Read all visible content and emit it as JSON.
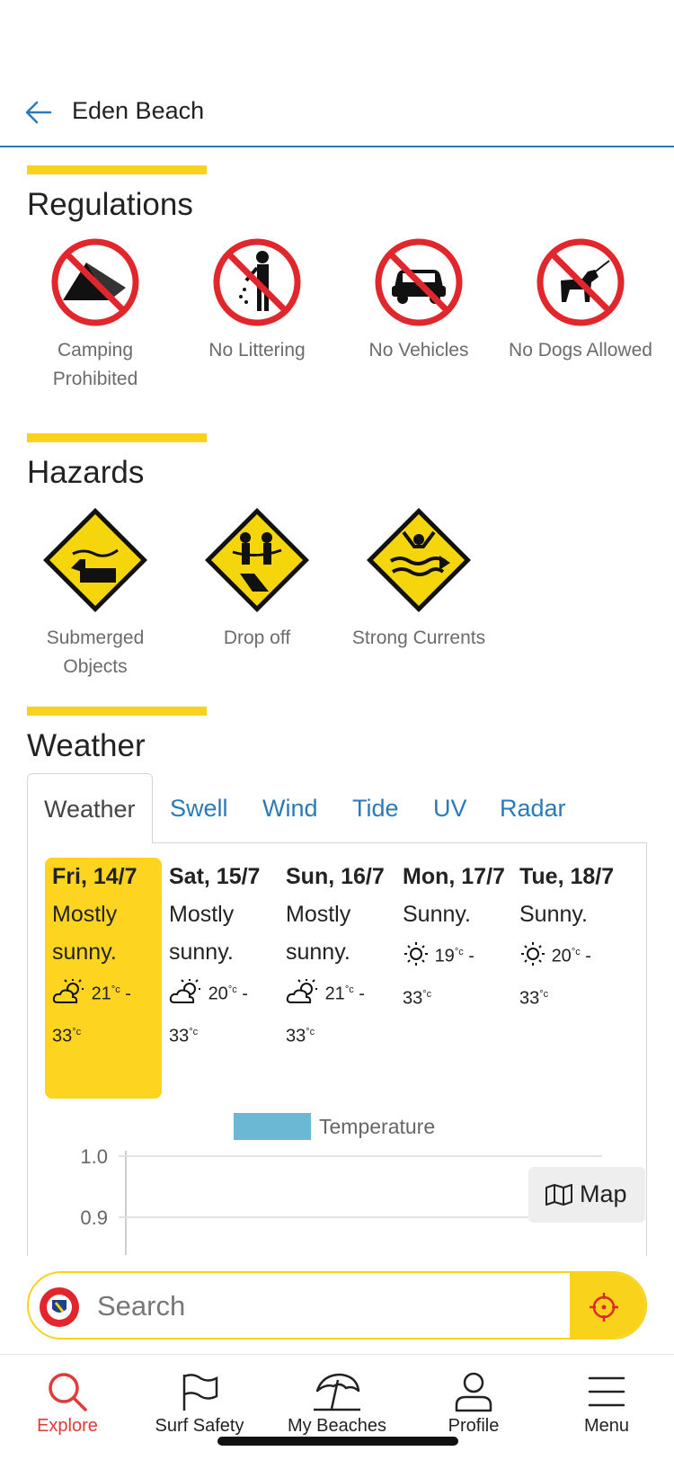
{
  "header": {
    "title": "Eden Beach"
  },
  "regulations": {
    "title": "Regulations",
    "items": [
      {
        "label": "Camping Prohibited",
        "icon": "no-camping-icon"
      },
      {
        "label": "No Littering",
        "icon": "no-littering-icon"
      },
      {
        "label": "No Vehicles",
        "icon": "no-vehicles-icon"
      },
      {
        "label": "No Dogs Allowed",
        "icon": "no-dogs-icon"
      }
    ]
  },
  "hazards": {
    "title": "Hazards",
    "items": [
      {
        "label": "Submerged Objects",
        "icon": "submerged-objects-icon"
      },
      {
        "label": "Drop off",
        "icon": "drop-off-icon"
      },
      {
        "label": "Strong Currents",
        "icon": "strong-currents-icon"
      }
    ]
  },
  "weather": {
    "title": "Weather",
    "tabs": [
      "Weather",
      "Swell",
      "Wind",
      "Tide",
      "UV",
      "Radar"
    ],
    "active_tab": "Weather",
    "days": [
      {
        "name": "Fri, 14/7",
        "desc": "Mostly sunny.",
        "icon": "partly-sunny-icon",
        "min": "21",
        "max": "33",
        "unit": "°c"
      },
      {
        "name": "Sat, 15/7",
        "desc": "Mostly sunny.",
        "icon": "partly-sunny-icon",
        "min": "20",
        "max": "33",
        "unit": "°c"
      },
      {
        "name": "Sun, 16/7",
        "desc": "Mostly sunny.",
        "icon": "partly-sunny-icon",
        "min": "21",
        "max": "33",
        "unit": "°c"
      },
      {
        "name": "Mon, 17/7",
        "desc": "Sunny.",
        "icon": "sun-icon",
        "min": "19",
        "max": "33",
        "unit": "°c"
      },
      {
        "name": "Tue, 18/7",
        "desc": "Sunny.",
        "icon": "sun-icon",
        "min": "20",
        "max": "33",
        "unit": "°c"
      }
    ],
    "legend": "Temperature",
    "legend_color": "#6ab8d4",
    "y_ticks": [
      "1.0",
      "0.9"
    ]
  },
  "map_button": {
    "label": "Map"
  },
  "search": {
    "placeholder": "Search"
  },
  "nav": {
    "items": [
      {
        "label": "Explore",
        "icon": "search-icon",
        "active": true
      },
      {
        "label": "Surf Safety",
        "icon": "flag-icon"
      },
      {
        "label": "My Beaches",
        "icon": "beach-umbrella-icon"
      },
      {
        "label": "Profile",
        "icon": "user-icon"
      },
      {
        "label": "Menu",
        "icon": "menu-icon"
      }
    ]
  },
  "colors": {
    "accent": "#f9d21c",
    "link": "#2a7ab8",
    "active_nav": "#e03a3a",
    "prohibit_red": "#e1262c"
  }
}
